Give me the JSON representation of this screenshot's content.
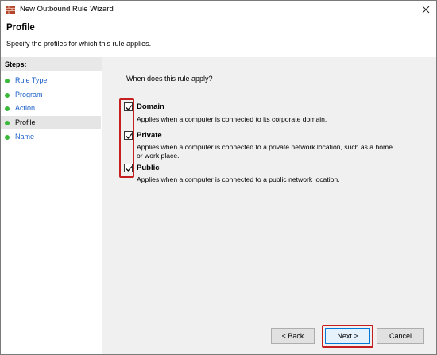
{
  "window": {
    "title": "New Outbound Rule Wizard"
  },
  "header": {
    "title": "Profile",
    "subtitle": "Specify the profiles for which this rule applies."
  },
  "steps": {
    "heading": "Steps:",
    "items": [
      {
        "label": "Rule Type",
        "current": false
      },
      {
        "label": "Program",
        "current": false
      },
      {
        "label": "Action",
        "current": false
      },
      {
        "label": "Profile",
        "current": true
      },
      {
        "label": "Name",
        "current": false
      }
    ]
  },
  "main": {
    "question": "When does this rule apply?",
    "options": [
      {
        "label": "Domain",
        "checked": true,
        "desc_line1": "Applies when a computer is connected to its corporate domain.",
        "desc_line2": ""
      },
      {
        "label": "Private",
        "checked": true,
        "desc_line1": "Applies when a computer is connected to a private network location, such as a home",
        "desc_line2": "or work place."
      },
      {
        "label": "Public",
        "checked": true,
        "desc_line1": "Applies when a computer is connected to a public network location.",
        "desc_line2": ""
      }
    ]
  },
  "buttons": {
    "back": "< Back",
    "next": "Next >",
    "cancel": "Cancel"
  },
  "colors": {
    "highlight": "#c41e1e",
    "link": "#1a5ec8",
    "step_dot": "#3ab83a"
  },
  "icons": {
    "window_icon": "firewall-wall-icon",
    "close": "close-icon",
    "step_bullet": "green-dot-icon",
    "checkmark": "checkmark-icon"
  }
}
